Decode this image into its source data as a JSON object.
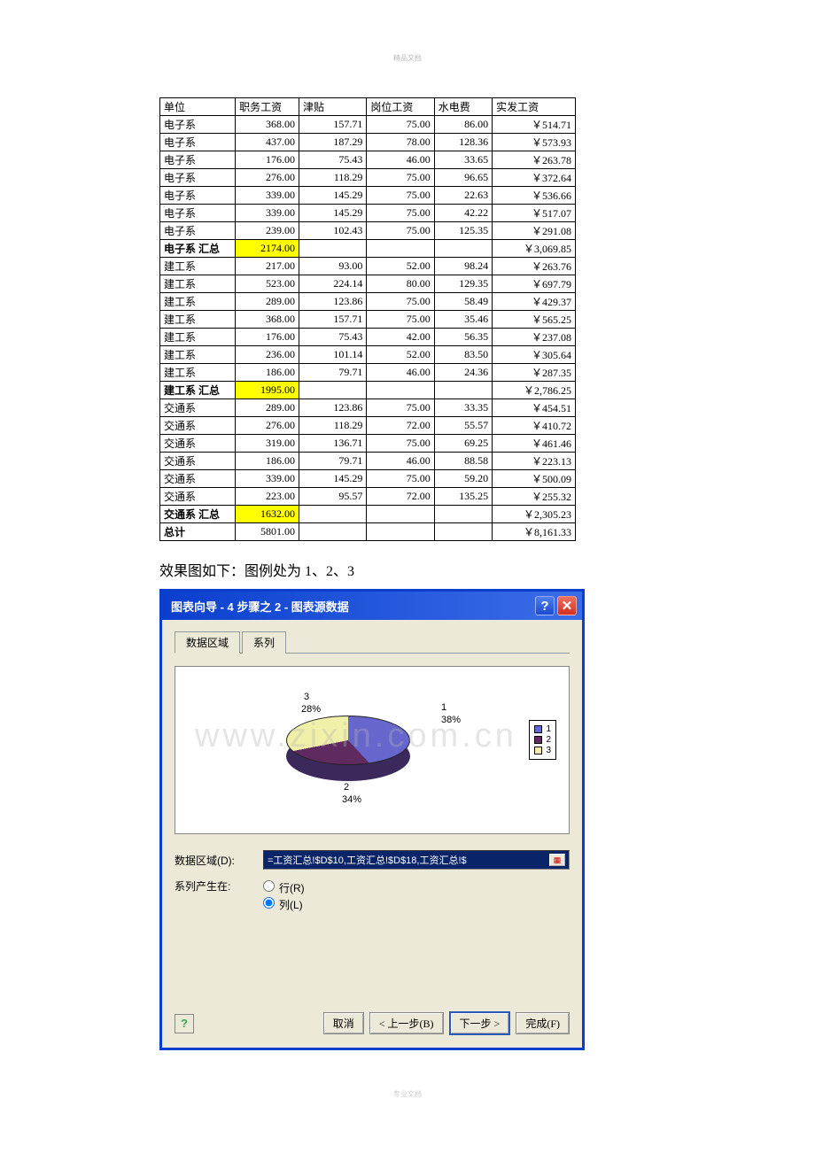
{
  "watermark_top": "精品文档",
  "watermark_bottom": "专业文档",
  "watermark_big": "www.zixin.com.cn",
  "table": {
    "headers": [
      "单位",
      "职务工资",
      "津贴",
      "岗位工资",
      "水电费",
      "实发工资"
    ],
    "rows": [
      {
        "c": [
          "电子系",
          "368.00",
          "157.71",
          "75.00",
          "86.00",
          "￥514.71"
        ]
      },
      {
        "c": [
          "电子系",
          "437.00",
          "187.29",
          "78.00",
          "128.36",
          "￥573.93"
        ]
      },
      {
        "c": [
          "电子系",
          "176.00",
          "75.43",
          "46.00",
          "33.65",
          "￥263.78"
        ]
      },
      {
        "c": [
          "电子系",
          "276.00",
          "118.29",
          "75.00",
          "96.65",
          "￥372.64"
        ]
      },
      {
        "c": [
          "电子系",
          "339.00",
          "145.29",
          "75.00",
          "22.63",
          "￥536.66"
        ]
      },
      {
        "c": [
          "电子系",
          "339.00",
          "145.29",
          "75.00",
          "42.22",
          "￥517.07"
        ]
      },
      {
        "c": [
          "电子系",
          "239.00",
          "102.43",
          "75.00",
          "125.35",
          "￥291.08"
        ]
      },
      {
        "c": [
          "电子系 汇总",
          "2174.00",
          "",
          "",
          "",
          "￥3,069.85"
        ],
        "sub": true
      },
      {
        "c": [
          "建工系",
          "217.00",
          "93.00",
          "52.00",
          "98.24",
          "￥263.76"
        ]
      },
      {
        "c": [
          "建工系",
          "523.00",
          "224.14",
          "80.00",
          "129.35",
          "￥697.79"
        ]
      },
      {
        "c": [
          "建工系",
          "289.00",
          "123.86",
          "75.00",
          "58.49",
          "￥429.37"
        ]
      },
      {
        "c": [
          "建工系",
          "368.00",
          "157.71",
          "75.00",
          "35.46",
          "￥565.25"
        ]
      },
      {
        "c": [
          "建工系",
          "176.00",
          "75.43",
          "42.00",
          "56.35",
          "￥237.08"
        ]
      },
      {
        "c": [
          "建工系",
          "236.00",
          "101.14",
          "52.00",
          "83.50",
          "￥305.64"
        ]
      },
      {
        "c": [
          "建工系",
          "186.00",
          "79.71",
          "46.00",
          "24.36",
          "￥287.35"
        ]
      },
      {
        "c": [
          "建工系 汇总",
          "1995.00",
          "",
          "",
          "",
          "￥2,786.25"
        ],
        "sub": true
      },
      {
        "c": [
          "交通系",
          "289.00",
          "123.86",
          "75.00",
          "33.35",
          "￥454.51"
        ]
      },
      {
        "c": [
          "交通系",
          "276.00",
          "118.29",
          "72.00",
          "55.57",
          "￥410.72"
        ]
      },
      {
        "c": [
          "交通系",
          "319.00",
          "136.71",
          "75.00",
          "69.25",
          "￥461.46"
        ]
      },
      {
        "c": [
          "交通系",
          "186.00",
          "79.71",
          "46.00",
          "88.58",
          "￥223.13"
        ]
      },
      {
        "c": [
          "交通系",
          "339.00",
          "145.29",
          "75.00",
          "59.20",
          "￥500.09"
        ]
      },
      {
        "c": [
          "交通系",
          "223.00",
          "95.57",
          "72.00",
          "135.25",
          "￥255.32"
        ]
      },
      {
        "c": [
          "交通系 汇总",
          "1632.00",
          "",
          "",
          "",
          "￥2,305.23"
        ],
        "sub": true
      },
      {
        "c": [
          "总计",
          "5801.00",
          "",
          "",
          "",
          "￥8,161.33"
        ],
        "grand": true
      }
    ]
  },
  "caption": "效果图如下：图例处为 1、2、3",
  "dialog": {
    "title": "图表向导 - 4 步骤之 2 - 图表源数据",
    "tab1": "数据区域",
    "tab2": "系列",
    "data_range_label": "数据区域(D):",
    "data_range_value": "=工资汇总!$D$10,工资汇总!$D$18,工资汇总!$",
    "series_in_label": "系列产生在:",
    "radio_row": "行(R)",
    "radio_col": "列(L)",
    "btn_cancel": "取消",
    "btn_back": "< 上一步(B)",
    "btn_next": "下一步 >",
    "btn_finish": "完成(F)"
  },
  "chart_data": {
    "type": "pie",
    "series": [
      {
        "name": "1",
        "value": 38
      },
      {
        "name": "2",
        "value": 34
      },
      {
        "name": "3",
        "value": 28
      }
    ],
    "labels": {
      "l1": "1",
      "l1p": "38%",
      "l2": "2",
      "l2p": "34%",
      "l3": "3",
      "l3p": "28%"
    },
    "legend": [
      "1",
      "2",
      "3"
    ]
  }
}
